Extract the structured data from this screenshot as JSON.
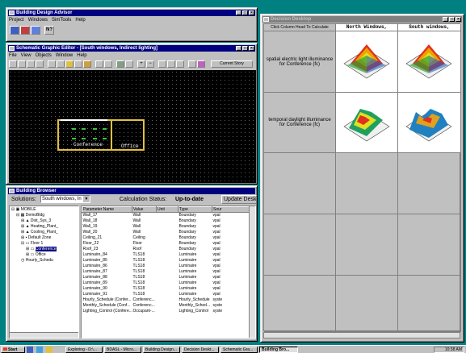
{
  "advisor": {
    "title": "Building Design Advisor",
    "menu": [
      "Project",
      "Windows",
      "SimTools",
      "Help"
    ]
  },
  "sge": {
    "title": "Schematic Graphic Editor - [South windows, Indirect lighting]",
    "menu": [
      "File",
      "View",
      "Objects",
      "Window",
      "Help"
    ],
    "current_story": "Current Story",
    "rooms": [
      {
        "label": "Conference"
      },
      {
        "label": "Office"
      }
    ]
  },
  "browser": {
    "title": "Building Browser",
    "solutions_label": "Solutions:",
    "solution_value": "South windows, In",
    "calc_label": "Calculation Status:",
    "calc_value": "Up-to-date",
    "update_btn": "Update Desk",
    "tree": [
      "MOBILE",
      "DemoBldg",
      "Dist_Sys_3",
      "Heating_Plant_",
      "Cooling_Plant_",
      "Default Zone",
      "Floor 1",
      "Conference",
      "Office",
      "Hourly_Schedu"
    ],
    "columns": [
      "Parameter Name",
      "Value",
      "Unit",
      "Type",
      "Sour"
    ],
    "rows": [
      [
        "Wall_17",
        "Wall",
        "",
        "Boundary",
        "vpal"
      ],
      [
        "Wall_18",
        "Wall",
        "",
        "Boundary",
        "vpal"
      ],
      [
        "Wall_19",
        "Wall",
        "",
        "Boundary",
        "vpal"
      ],
      [
        "Wall_20",
        "Wall",
        "",
        "Boundary",
        "vpal"
      ],
      [
        "Ceiling_21",
        "Ceiling",
        "",
        "Boundary",
        "vpal"
      ],
      [
        "Floor_22",
        "Floor",
        "",
        "Boundary",
        "vpal"
      ],
      [
        "Roof_23",
        "Roof",
        "",
        "Boundary",
        "vpal"
      ],
      [
        "Luminaire_84",
        "TLS18",
        "",
        "Luminaire",
        "vpal"
      ],
      [
        "Luminaire_85",
        "TLS18",
        "",
        "Luminaire",
        "vpal"
      ],
      [
        "Luminaire_86",
        "TLS18",
        "",
        "Luminaire",
        "vpal"
      ],
      [
        "Luminaire_87",
        "TLS18",
        "",
        "Luminaire",
        "vpal"
      ],
      [
        "Luminaire_88",
        "TLS18",
        "",
        "Luminaire",
        "vpal"
      ],
      [
        "Luminaire_89",
        "TLS18",
        "",
        "Luminaire",
        "vpal"
      ],
      [
        "Luminaire_90",
        "TLS18",
        "",
        "Luminaire",
        "vpal"
      ],
      [
        "Luminaire_91",
        "TLS18",
        "",
        "Luminaire",
        "vpal"
      ],
      [
        "Hourly_Schedule (Confer...",
        "Conferenc...",
        "",
        "Hourly_Schedule",
        "syste"
      ],
      [
        "Monthly_Schedule (Conf...",
        "Conferenc...",
        "",
        "Monthly_Sched...",
        "syste"
      ],
      [
        "Lighting_Control (Confere...",
        "Occupant-...",
        "",
        "Lighting_Control",
        "syste"
      ]
    ]
  },
  "desktop": {
    "title": "Decision Desktop",
    "header": "Click Column Head To Calculate",
    "col1": "North Windows,",
    "col2": "South windows,",
    "row1": "spatial electric light illuminance for Conference (fc)",
    "row2": "temporal daylight illuminance for Conference (fc)"
  },
  "taskbar": {
    "start": "Start",
    "items": [
      "Exploring - D:\\...",
      "BDASL - Micro...",
      "Building Design...",
      "Decision Deskt...",
      "Schematic Gra...",
      "Building Bro..."
    ],
    "clock": "10:38 AM"
  }
}
